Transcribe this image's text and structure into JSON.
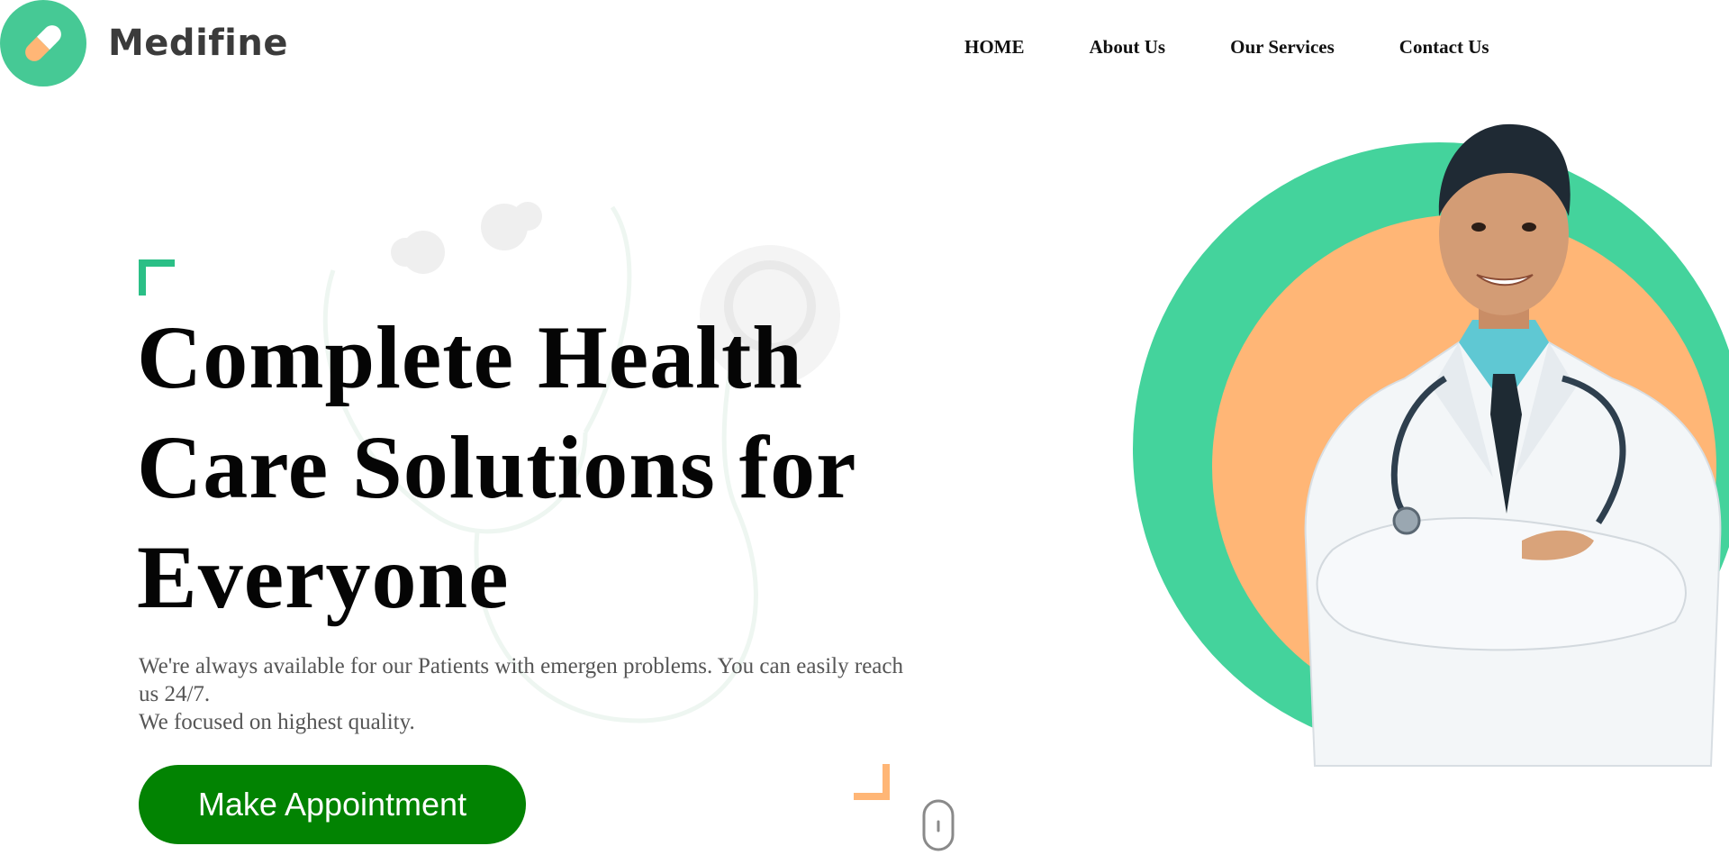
{
  "header": {
    "logo_text": "Medifine",
    "nav": [
      {
        "label": "HOME"
      },
      {
        "label": "About Us"
      },
      {
        "label": "Our Services"
      },
      {
        "label": "Contact Us"
      }
    ]
  },
  "hero": {
    "title": "Complete Health Care Solutions for Everyone",
    "description_line1": "We're always available for our Patients with emergen problems. You can easily reach us 24/7.",
    "description_line2": "We focused on highest quality.",
    "cta_label": "Make Appointment"
  },
  "icons": {
    "logo": "pill-icon",
    "background": "stethoscope-icon",
    "scroll": "mouse-scroll-icon"
  },
  "colors": {
    "brand_green": "#44d39c",
    "accent_orange": "#ffb676",
    "cta_green": "#028302",
    "title_text": "#050505",
    "body_text": "#555555"
  }
}
